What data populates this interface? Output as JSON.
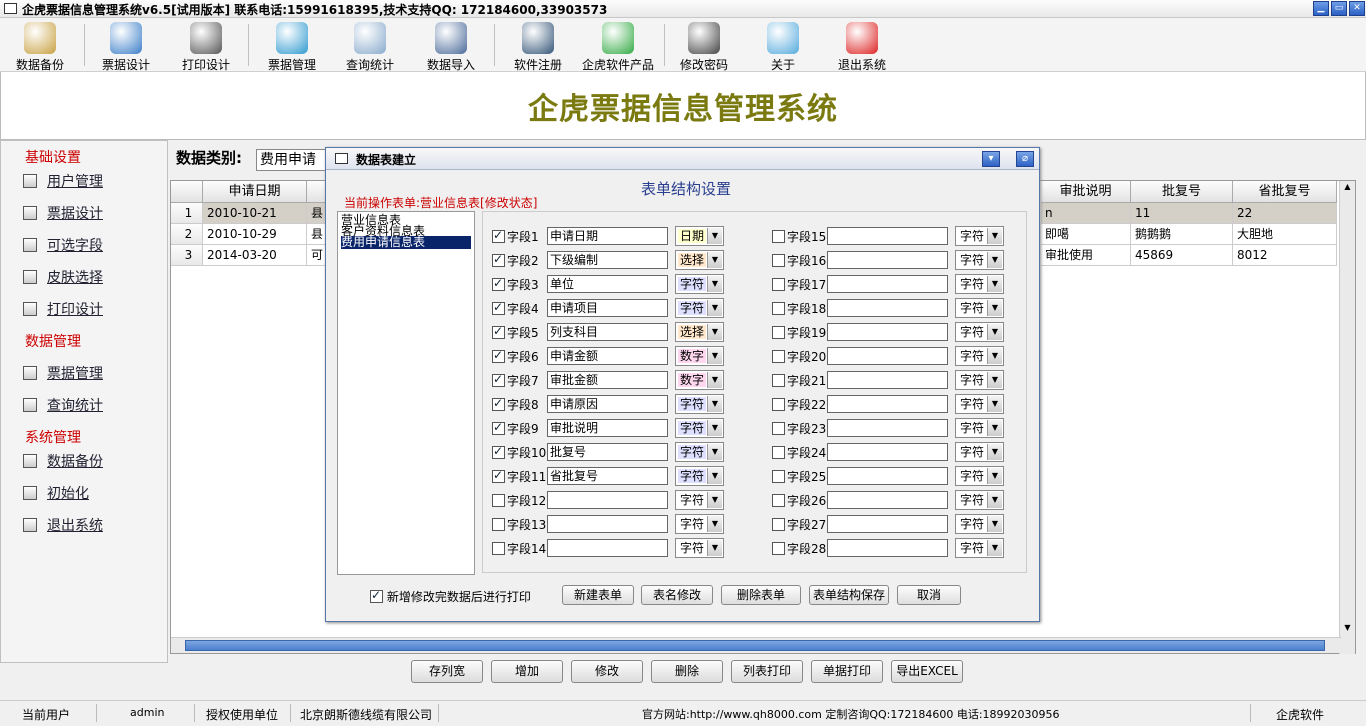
{
  "titlebar": {
    "title": "企虎票据信息管理系统v6.5[试用版本]   联系电话:15991618395,技术支持QQ: 172184600,33903573"
  },
  "toolbar": [
    {
      "label": "数据备份",
      "icon": "database-backup-icon",
      "color": "#c8a040"
    },
    {
      "label": "票据设计",
      "icon": "design-check-icon",
      "color": "#3a7ec8"
    },
    {
      "label": "打印设计",
      "icon": "printer-icon",
      "color": "#555555"
    },
    {
      "label": "票据管理",
      "icon": "folder-manage-icon",
      "color": "#2f9ad0"
    },
    {
      "label": "查询统计",
      "icon": "magnifier-icon",
      "color": "#88aacc"
    },
    {
      "label": "数据导入",
      "icon": "database-import-icon",
      "color": "#4a6a9a"
    },
    {
      "label": "软件注册",
      "icon": "register-icon",
      "color": "#335577"
    },
    {
      "label": "企虎软件产品",
      "icon": "refresh-icon",
      "color": "#33aa44"
    },
    {
      "label": "修改密码",
      "icon": "key-icon",
      "color": "#444444"
    },
    {
      "label": "关于",
      "icon": "about-chat-icon",
      "color": "#55aadd"
    },
    {
      "label": "退出系统",
      "icon": "exit-cube-icon",
      "color": "#dd2222"
    }
  ],
  "banner": {
    "title": "企虎票据信息管理系统"
  },
  "sidebar": {
    "sections": [
      {
        "title": "基础设置",
        "items": [
          "用户管理",
          "票据设计",
          "可选字段",
          "皮肤选择",
          "打印设计"
        ]
      },
      {
        "title": "数据管理",
        "items": [
          "票据管理",
          "查询统计"
        ]
      },
      {
        "title": "系统管理",
        "items": [
          "数据备份",
          "初始化",
          "退出系统"
        ]
      }
    ]
  },
  "main": {
    "category_label": "数据类别:",
    "category_value": "费用申请",
    "grid": {
      "left_headers": [
        "申请日期"
      ],
      "right_headers": [
        "审批说明",
        "批复号",
        "省批复号"
      ],
      "rows": [
        {
          "n": "1",
          "date": "2010-10-21",
          "c2": "县",
          "remark": "n",
          "reply": "11",
          "prov": "22"
        },
        {
          "n": "2",
          "date": "2010-10-29",
          "c2": "县",
          "remark": "即噶",
          "reply": "鹅鹅鹅",
          "prov": "大胆地"
        },
        {
          "n": "3",
          "date": "2014-03-20",
          "c2": "可",
          "remark": "审批使用",
          "reply": "45869",
          "prov": "8012"
        }
      ]
    }
  },
  "bottom_buttons": [
    "存列宽",
    "增加",
    "修改",
    "删除",
    "列表打印",
    "单据打印",
    "导出EXCEL"
  ],
  "status": {
    "user_label": "当前用户",
    "user": "admin",
    "licensed_label": "授权使用单位",
    "licensed": "北京朗斯德线缆有限公司",
    "website": "官方网站:http://www.qh8000.com 定制咨询QQ:172184600 电话:18992030956",
    "brand": "企虎软件"
  },
  "dialog": {
    "title": "数据表建立",
    "header": "表单结构设置",
    "current_op": "当前操作表单:营业信息表[修改状态]",
    "tables": [
      "营业信息表",
      "客户资料信息表",
      "费用申请信息表"
    ],
    "fields_left": [
      {
        "label": "字段1",
        "checked": true,
        "value": "申请日期",
        "type": "日期",
        "color": "#ffffcc"
      },
      {
        "label": "字段2",
        "checked": true,
        "value": "下级编制",
        "type": "选择",
        "color": "#ffe8cc"
      },
      {
        "label": "字段3",
        "checked": true,
        "value": "单位",
        "type": "字符",
        "color": "#dde0ff"
      },
      {
        "label": "字段4",
        "checked": true,
        "value": "申请项目",
        "type": "字符",
        "color": "#dde0ff"
      },
      {
        "label": "字段5",
        "checked": true,
        "value": "列支科目",
        "type": "选择",
        "color": "#ffe8cc"
      },
      {
        "label": "字段6",
        "checked": true,
        "value": "申请金额",
        "type": "数字",
        "color": "#ffd8f0"
      },
      {
        "label": "字段7",
        "checked": true,
        "value": "审批金额",
        "type": "数字",
        "color": "#ffd8f0"
      },
      {
        "label": "字段8",
        "checked": true,
        "value": "申请原因",
        "type": "字符",
        "color": "#dde0ff"
      },
      {
        "label": "字段9",
        "checked": true,
        "value": "审批说明",
        "type": "字符",
        "color": "#dde0ff"
      },
      {
        "label": "字段10",
        "checked": true,
        "value": "批复号",
        "type": "字符",
        "color": "#dde0ff"
      },
      {
        "label": "字段11",
        "checked": true,
        "value": "省批复号",
        "type": "字符",
        "color": "#dde0ff"
      },
      {
        "label": "字段12",
        "checked": false,
        "value": "",
        "type": "字符",
        "color": "#ffffff"
      },
      {
        "label": "字段13",
        "checked": false,
        "value": "",
        "type": "字符",
        "color": "#ffffff"
      },
      {
        "label": "字段14",
        "checked": false,
        "value": "",
        "type": "字符",
        "color": "#ffffff"
      }
    ],
    "fields_right": [
      {
        "label": "字段15",
        "checked": false,
        "value": "",
        "type": "字符",
        "color": "#ffffff"
      },
      {
        "label": "字段16",
        "checked": false,
        "value": "",
        "type": "字符",
        "color": "#ffffff"
      },
      {
        "label": "字段17",
        "checked": false,
        "value": "",
        "type": "字符",
        "color": "#ffffff"
      },
      {
        "label": "字段18",
        "checked": false,
        "value": "",
        "type": "字符",
        "color": "#ffffff"
      },
      {
        "label": "字段19",
        "checked": false,
        "value": "",
        "type": "字符",
        "color": "#ffffff"
      },
      {
        "label": "字段20",
        "checked": false,
        "value": "",
        "type": "字符",
        "color": "#ffffff"
      },
      {
        "label": "字段21",
        "checked": false,
        "value": "",
        "type": "字符",
        "color": "#ffffff"
      },
      {
        "label": "字段22",
        "checked": false,
        "value": "",
        "type": "字符",
        "color": "#ffffff"
      },
      {
        "label": "字段23",
        "checked": false,
        "value": "",
        "type": "字符",
        "color": "#ffffff"
      },
      {
        "label": "字段24",
        "checked": false,
        "value": "",
        "type": "字符",
        "color": "#ffffff"
      },
      {
        "label": "字段25",
        "checked": false,
        "value": "",
        "type": "字符",
        "color": "#ffffff"
      },
      {
        "label": "字段26",
        "checked": false,
        "value": "",
        "type": "字符",
        "color": "#ffffff"
      },
      {
        "label": "字段27",
        "checked": false,
        "value": "",
        "type": "字符",
        "color": "#ffffff"
      },
      {
        "label": "字段28",
        "checked": false,
        "value": "",
        "type": "字符",
        "color": "#ffffff"
      }
    ],
    "print_after_save": {
      "label": "新增修改完数据后进行打印",
      "checked": true
    },
    "buttons": [
      "新建表单",
      "表名修改",
      "删除表单",
      "表单结构保存",
      "取消"
    ]
  }
}
